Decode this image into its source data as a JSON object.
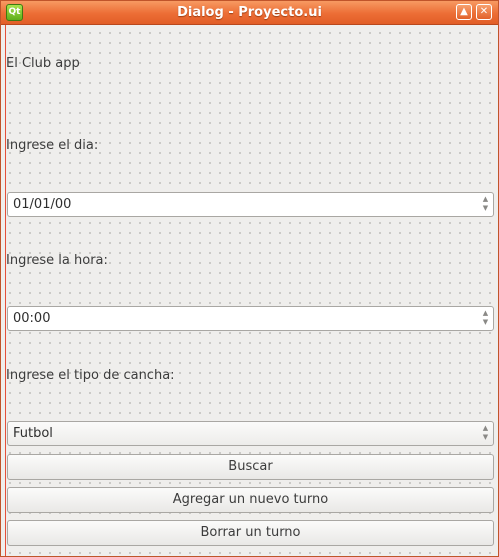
{
  "window": {
    "title": "Dialog - Proyecto.ui",
    "icon_text": "Qt",
    "icon": "qt-designer-icon",
    "controls": {
      "restore_icon": "maximize-icon",
      "close_icon": "close-icon"
    }
  },
  "form": {
    "app_label": "El Club app",
    "day_label": "Ingrese el dia:",
    "day_value": "01/01/00",
    "hour_label": "Ingrese la hora:",
    "hour_value": "00:00",
    "court_label": "Ingrese el tipo de cancha:",
    "court_value": "Futbol"
  },
  "buttons": {
    "search": "Buscar",
    "add": "Agregar un nuevo turno",
    "delete": "Borrar un turno"
  },
  "colors": {
    "titlebar": "#ec6d35",
    "window_bg": "#efeeec",
    "guide_line": "#e4503a"
  }
}
